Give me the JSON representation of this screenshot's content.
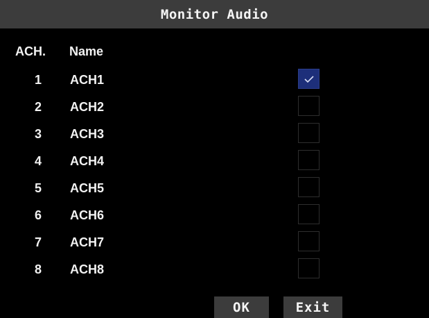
{
  "title": "Monitor Audio",
  "headers": {
    "ach": "ACH.",
    "name": "Name"
  },
  "channels": [
    {
      "num": "1",
      "name": "ACH1",
      "checked": true
    },
    {
      "num": "2",
      "name": "ACH2",
      "checked": false
    },
    {
      "num": "3",
      "name": "ACH3",
      "checked": false
    },
    {
      "num": "4",
      "name": "ACH4",
      "checked": false
    },
    {
      "num": "5",
      "name": "ACH5",
      "checked": false
    },
    {
      "num": "6",
      "name": "ACH6",
      "checked": false
    },
    {
      "num": "7",
      "name": "ACH7",
      "checked": false
    },
    {
      "num": "8",
      "name": "ACH8",
      "checked": false
    }
  ],
  "buttons": {
    "ok": "OK",
    "exit": "Exit"
  },
  "colors": {
    "titlebar": "#3c3c3c",
    "checked": "#1d2f7a",
    "background": "#000000"
  },
  "icons": {
    "check": "check-icon"
  }
}
